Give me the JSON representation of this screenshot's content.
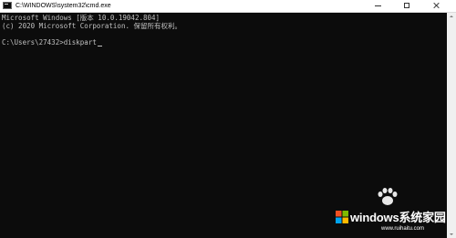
{
  "window": {
    "title": "C:\\WINDOWS\\system32\\cmd.exe",
    "buttons": {
      "minimize": "minimize",
      "maximize": "maximize",
      "close": "close"
    }
  },
  "console": {
    "lines": [
      "Microsoft Windows [版本 10.0.19042.804]",
      "(c) 2020 Microsoft Corporation. 保留所有权利。",
      "",
      "C:\\Users\\27432>diskpart"
    ],
    "text_color": "#c0c0c0",
    "background": "#0c0c0c"
  },
  "watermark": {
    "brand": "windows系统家园",
    "url": "www.ruihaitu.com",
    "accent_colors": [
      "#00a4ef",
      "#7fba00",
      "#ffb900",
      "#f25022"
    ],
    "icons": [
      "paw-icon",
      "windows-logo-icon"
    ]
  }
}
